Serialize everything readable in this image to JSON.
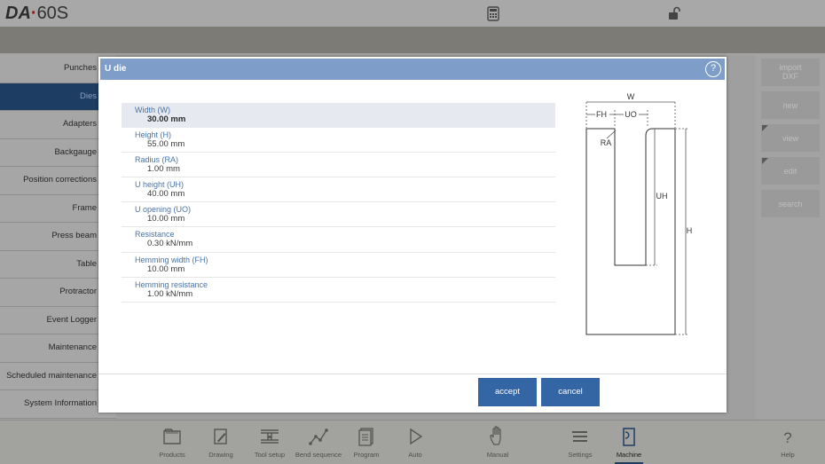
{
  "app": {
    "logo_brand": "DA",
    "logo_dot": "·",
    "logo_model": "60S"
  },
  "topbar": {
    "icons": [
      "calculator-icon",
      "unlock-icon"
    ]
  },
  "sidebar": {
    "items": [
      {
        "label": "Punches"
      },
      {
        "label": "Dies",
        "active": true
      },
      {
        "label": "Adapters"
      },
      {
        "label": "Backgauge"
      },
      {
        "label": "Position corrections"
      },
      {
        "label": "Frame"
      },
      {
        "label": "Press beam"
      },
      {
        "label": "Table"
      },
      {
        "label": "Protractor"
      },
      {
        "label": "Event Logger"
      },
      {
        "label": "Maintenance"
      },
      {
        "label": "Scheduled maintenance"
      },
      {
        "label": "System Information"
      }
    ]
  },
  "right_panel": {
    "buttons": [
      {
        "label": "import DXF"
      },
      {
        "label": "new"
      },
      {
        "label": "view"
      },
      {
        "label": "edit"
      },
      {
        "label": "search"
      }
    ]
  },
  "dialog": {
    "title": "U die",
    "help_label": "?",
    "params": [
      {
        "label": "Width (W)",
        "value": "30.00 mm",
        "selected": true
      },
      {
        "label": "Height (H)",
        "value": "55.00 mm"
      },
      {
        "label": "Radius (RA)",
        "value": "1.00 mm"
      },
      {
        "label": "U height (UH)",
        "value": "40.00 mm"
      },
      {
        "label": "U opening (UO)",
        "value": "10.00 mm"
      },
      {
        "label": "Resistance",
        "value": "0.30 kN/mm"
      },
      {
        "label": "Hemming width (FH)",
        "value": "10.00 mm"
      },
      {
        "label": "Hemming resistance",
        "value": "1.00 kN/mm"
      }
    ],
    "diagram_labels": {
      "w": "W",
      "fh": "FH",
      "uo": "UO",
      "ra": "RA",
      "uh": "UH",
      "h": "H"
    },
    "accept_label": "accept",
    "cancel_label": "cancel"
  },
  "bottom_nav": {
    "items": [
      {
        "label": "Products",
        "icon": "folder-icon"
      },
      {
        "label": "Drawing",
        "icon": "drawing-icon"
      },
      {
        "label": "Tool setup",
        "icon": "tool-setup-icon"
      },
      {
        "label": "Bend sequence",
        "icon": "bend-sequence-icon"
      },
      {
        "label": "Program",
        "icon": "program-icon"
      },
      {
        "label": "Auto",
        "icon": "play-icon"
      },
      {
        "label": "Manual",
        "icon": "hand-icon"
      },
      {
        "label": "Settings",
        "icon": "settings-list-icon"
      },
      {
        "label": "Machine",
        "icon": "machine-icon",
        "active": true
      },
      {
        "label": "Help",
        "icon": "help-icon"
      }
    ]
  }
}
